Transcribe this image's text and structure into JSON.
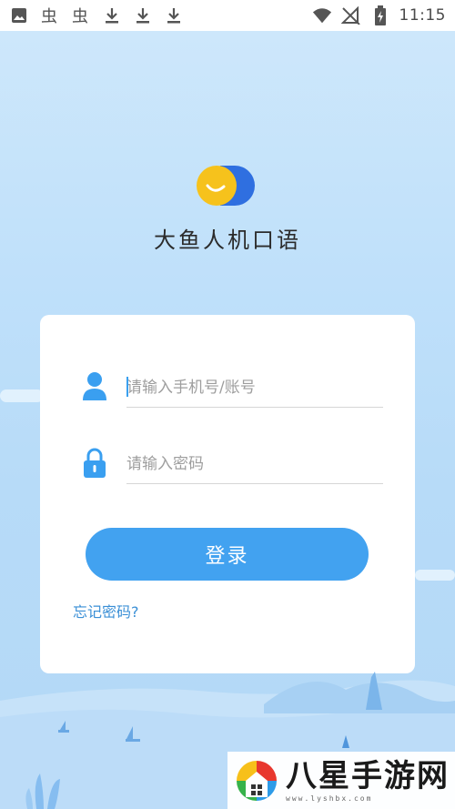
{
  "status_bar": {
    "time": "11:15",
    "left_icons": [
      "image-icon",
      "bug-icon",
      "bug-icon",
      "download-icon",
      "download-icon",
      "download-icon"
    ],
    "right_icons": [
      "wifi-icon",
      "no-signal-icon",
      "battery-charging-icon"
    ]
  },
  "app": {
    "title": "大鱼人机口语"
  },
  "login": {
    "account_placeholder": "请输入手机号/账号",
    "password_placeholder": "请输入密码",
    "login_button": "登录",
    "forgot_password": "忘记密码?"
  },
  "watermark": {
    "title": "八星手游网",
    "url": "www.lyshbx.com"
  },
  "colors": {
    "accent": "#42a2f0",
    "link": "#3a8fd6",
    "logo_yellow": "#f6c21c",
    "logo_blue": "#2f6fe0"
  }
}
